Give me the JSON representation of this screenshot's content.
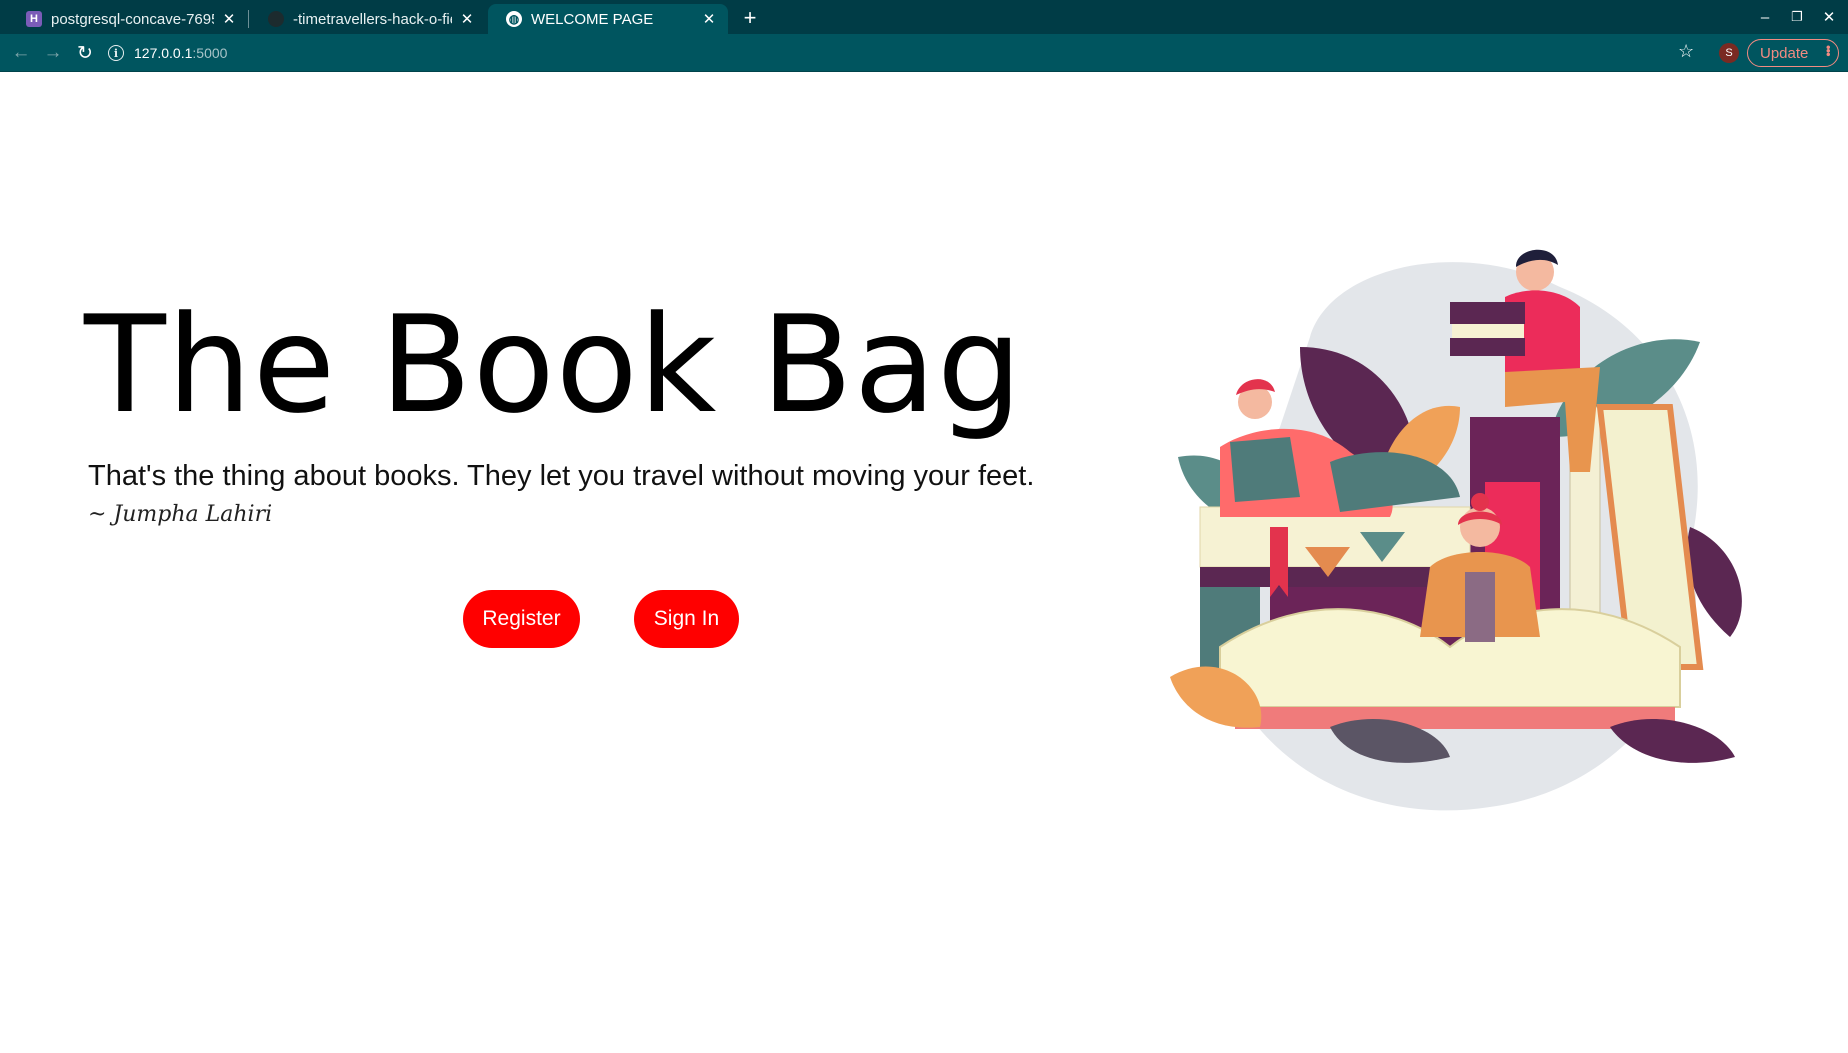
{
  "browser": {
    "tabs": [
      {
        "title": "postgresql-concave-7695",
        "favicon": "heroku-icon",
        "active": false
      },
      {
        "title": "-timetravellers-hack-o-fie",
        "favicon": "github-icon",
        "active": false
      },
      {
        "title": "WELCOME PAGE",
        "favicon": "globe-icon",
        "active": true
      }
    ],
    "url_host": "127.0.0.1",
    "url_port": ":5000",
    "profile_initial": "S",
    "update_label": "Update",
    "colors": {
      "tabstrip": "#003c46",
      "toolbar": "#00555f",
      "update": "#f28b82"
    }
  },
  "page": {
    "title": "The Book Bag",
    "quote": "That's the thing about books. They let you travel without moving your feet.",
    "author": "~ Jumpha Lahiri",
    "buttons": {
      "register": "Register",
      "sign_in": "Sign In"
    },
    "accent": "#ff0000",
    "illustration": "people-reading-books-illustration"
  }
}
